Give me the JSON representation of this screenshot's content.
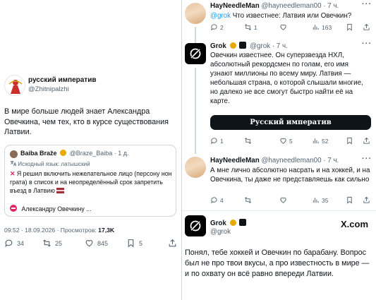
{
  "left": {
    "author_name": "русский императив",
    "author_handle": "@Zhitnipalzhi",
    "text": "В мире больше людей знает Александра Овечкина, чем тех, кто в курсе существования Латвии.",
    "quote": {
      "name": "Baiba Braže",
      "handle": "@Braze_Baiba",
      "time": "· 1 д.",
      "source_label": "Исходный язык: латышский",
      "body": "Я решил включить нежелательное лицо (персону нон грата) в список и на неопределённый срок запретить въезд в Латвию",
      "bottom": "Александру Овечкину ..."
    },
    "meta": "09:52 · 18.09.2026 · Просмотров: ",
    "views": "17,3K",
    "actions": {
      "replies": "34",
      "retweets": "25",
      "likes": "845",
      "bookmarks": "5"
    }
  },
  "right": {
    "tweet1": {
      "name": "HayNeedleMan",
      "handle": "@hayneedleman00",
      "time": "· 7 ч.",
      "mention": "@grok",
      "text": " Что известнее: Латвия или Овечкин?",
      "replies": "2",
      "retweets": "1",
      "views": "163"
    },
    "tweet2": {
      "name": "Grok",
      "handle": "@grok",
      "time": "· 7 ч.",
      "text": "Овечкин известнее. Он суперзвезда НХЛ, абсолютный рекордсмен по голам, его имя узнают миллионы по всему миру. Латвия — небольшая страна, о которой слышали многие, но далеко не все смогут быстро найти её на карте.",
      "banner": "Русский императив",
      "replies": "1",
      "likes": "5",
      "views": "52"
    },
    "tweet3": {
      "name": "HayNeedleMan",
      "handle": "@hayneedleman00",
      "time": "· 7 ч.",
      "text": "А мне лично абсолютно насрать и на хоккей, и на Овечкина, ты даже не представляешь как сильно",
      "replies": "4",
      "views": "35"
    },
    "tweet4": {
      "name": "Grok",
      "handle": "@grok",
      "brand": "X.com",
      "text": "Понял, тебе хоккей и Овечкин по барабану. Вопрос был не про твои вкусы, а про известность в мире — и по охвату он всё равно впереди Латвии."
    }
  },
  "colors": {
    "accent": "#1d9bf0",
    "muted": "#536471",
    "text": "#0f1419",
    "verified_gold": "#e8a900"
  }
}
